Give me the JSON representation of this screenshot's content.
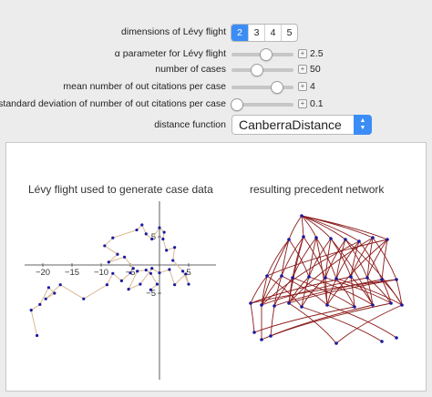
{
  "controls": {
    "dimensions": {
      "label": "dimensions of Lévy flight",
      "options": [
        "2",
        "3",
        "4",
        "5"
      ],
      "selected": "2"
    },
    "alpha": {
      "label": "α parameter for Lévy flight",
      "value": "2.5",
      "fraction": 0.55
    },
    "cases": {
      "label": "number of cases",
      "value": "50",
      "fraction": 0.4
    },
    "mean_out": {
      "label": "mean number of out citations per case",
      "value": "4",
      "fraction": 0.72
    },
    "sd_out": {
      "label": "standard deviation of number of out citations per case",
      "value": "0.1",
      "fraction": 0.08
    },
    "distance": {
      "label": "distance function",
      "value": "CanberraDistance"
    }
  },
  "plot_left": {
    "title": "Lévy flight used to generate case data",
    "x_ticks": [
      "−20",
      "−15",
      "−10",
      "−5",
      "5"
    ],
    "y_ticks": [
      "5",
      "−5"
    ],
    "colors": {
      "path": "#d9b892",
      "point": "#1a1a9e",
      "axis": "#333333"
    }
  },
  "plot_right": {
    "title": "resulting precedent network",
    "colors": {
      "edge": "#8b1a1a",
      "node": "#1a1a9e"
    }
  }
}
